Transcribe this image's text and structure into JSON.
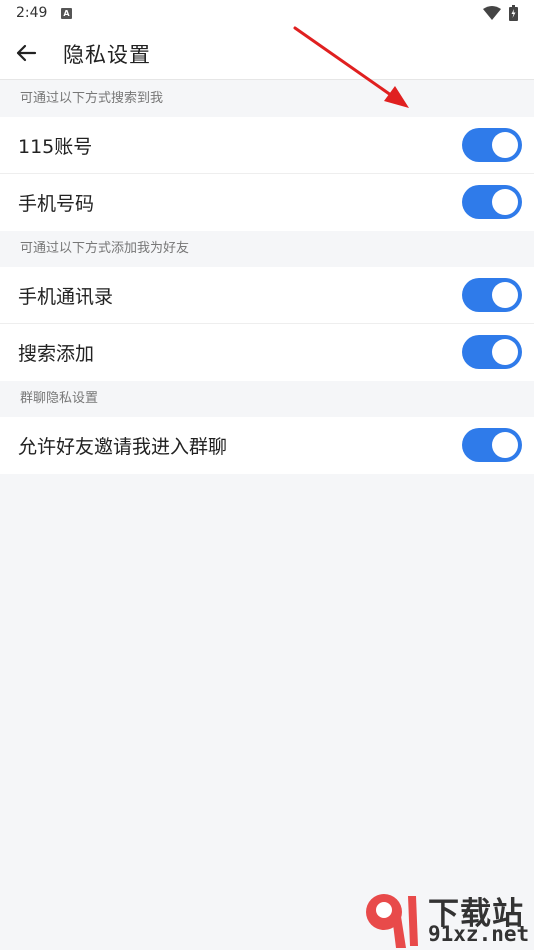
{
  "status_bar": {
    "time": "2:49",
    "notification_glyph": "A"
  },
  "app_bar": {
    "title": "隐私设置"
  },
  "sections": [
    {
      "header": "可通过以下方式搜索到我",
      "rows": [
        {
          "label": "115账号",
          "enabled": true
        },
        {
          "label": "手机号码",
          "enabled": true
        }
      ]
    },
    {
      "header": "可通过以下方式添加我为好友",
      "rows": [
        {
          "label": "手机通讯录",
          "enabled": true
        },
        {
          "label": "搜索添加",
          "enabled": true
        }
      ]
    },
    {
      "header": "群聊隐私设置",
      "rows": [
        {
          "label": "允许好友邀请我进入群聊",
          "enabled": true
        }
      ]
    }
  ],
  "watermark": {
    "title": "下载站",
    "url": "91xz.net"
  },
  "colors": {
    "toggle_on": "#2f7bea",
    "annotation_arrow": "#e02020",
    "background": "#f5f6f8"
  },
  "icons": [
    "wifi-icon",
    "battery-icon",
    "back-arrow-icon",
    "annotation-arrow-icon",
    "site-logo-icon"
  ]
}
